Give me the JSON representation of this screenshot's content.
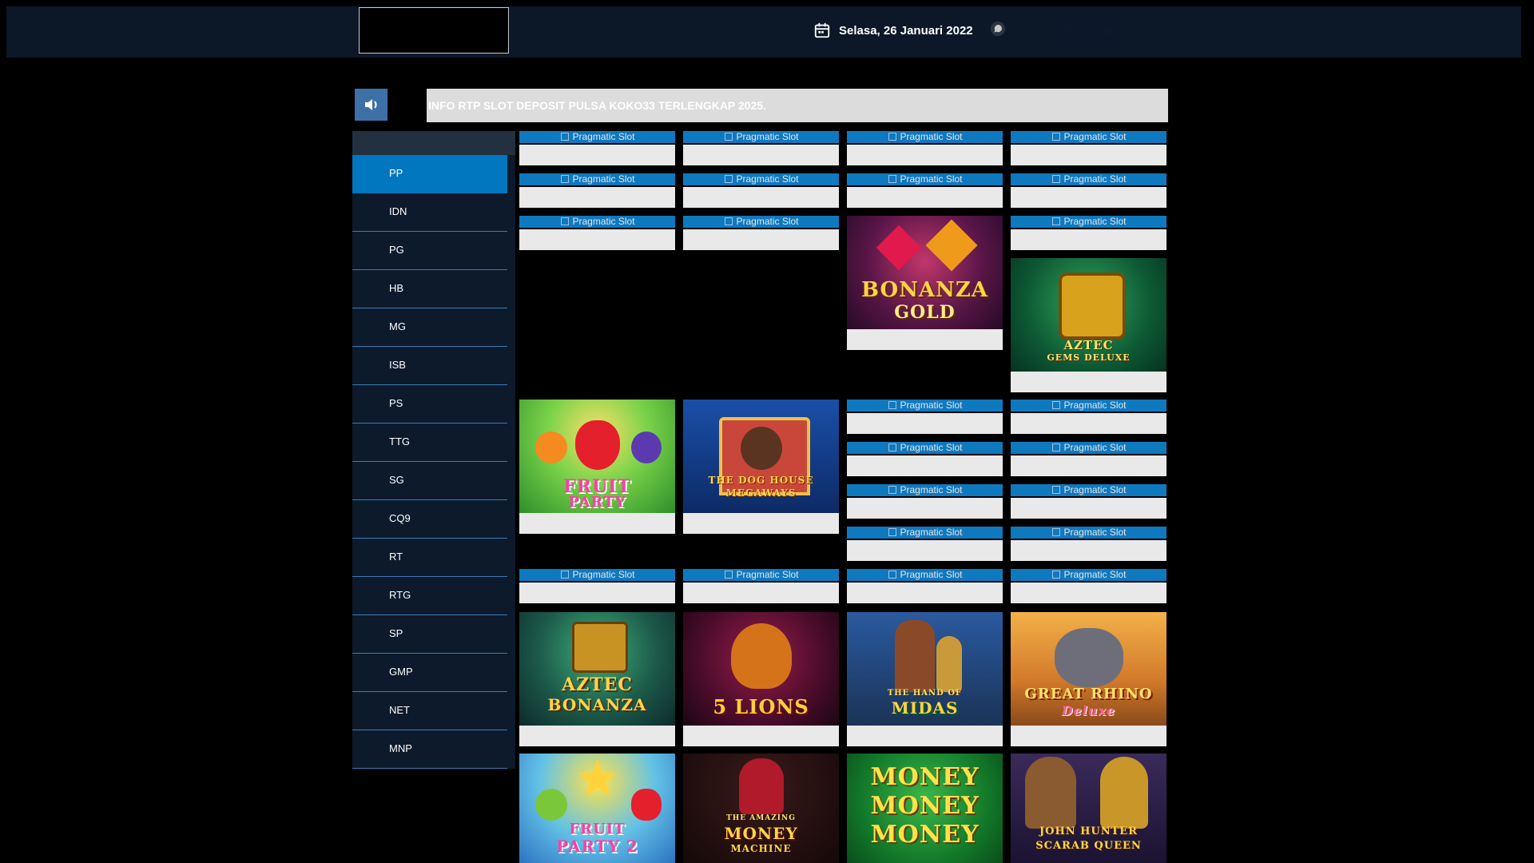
{
  "header": {
    "date": "Selasa, 26 Januari 2022",
    "contact_label": "WhatsApp",
    "icons": {
      "calendar": "calendar-icon",
      "whatsapp": "whatsapp-icon",
      "speaker": "speaker-icon"
    }
  },
  "announcement": {
    "text": "INFO RTP SLOT DEPOSIT PULSA KOKO33 TERLENGKAP 2025."
  },
  "providers": [
    {
      "label": "PP",
      "active": true
    },
    {
      "label": "IDN"
    },
    {
      "label": "PG"
    },
    {
      "label": "HB"
    },
    {
      "label": "MG"
    },
    {
      "label": "ISB"
    },
    {
      "label": "PS"
    },
    {
      "label": "TTG"
    },
    {
      "label": "SG"
    },
    {
      "label": "CQ9"
    },
    {
      "label": "RT"
    },
    {
      "label": "RTG"
    },
    {
      "label": "SP"
    },
    {
      "label": "GMP"
    },
    {
      "label": "NET"
    },
    {
      "label": "MNP"
    }
  ],
  "games": {
    "broken_image_alt": "Pragmatic Slot",
    "featured": [
      {
        "title_lines": [
          "BONANZA",
          "GOLD"
        ]
      },
      {
        "title_lines": [
          "AZTEC",
          "GEMS DELUXE"
        ]
      },
      {
        "title_lines": [
          "FRUIT",
          "PARTY"
        ]
      },
      {
        "title_lines": [
          "THE DOG HOUSE",
          "MEGAWAYS"
        ]
      },
      {
        "title_lines": [
          "AZTEC",
          "BONANZA"
        ]
      },
      {
        "title_lines": [
          "5 LIONS"
        ]
      },
      {
        "title_lines": [
          "THE HAND OF",
          "MIDAS"
        ]
      },
      {
        "title_lines": [
          "GREAT RHINO",
          "Deluxe"
        ]
      },
      {
        "title_lines": [
          "FRUIT",
          "PARTY 2"
        ]
      },
      {
        "title_lines": [
          "THE AMAZING",
          "MONEY",
          "MACHINE"
        ]
      },
      {
        "title_lines": [
          "MONEY",
          "MONEY",
          "MONEY"
        ]
      },
      {
        "title_lines": [
          "JOHN HUNTER",
          "SCARAB QUEEN"
        ]
      }
    ]
  },
  "colors": {
    "header_bg": "#0c1727",
    "accent_blue": "#0f79c0",
    "sidebar_bg": "#0d1a2c",
    "sidebar_active": "#0077bf",
    "marquee_bg": "#dcdcdc"
  }
}
